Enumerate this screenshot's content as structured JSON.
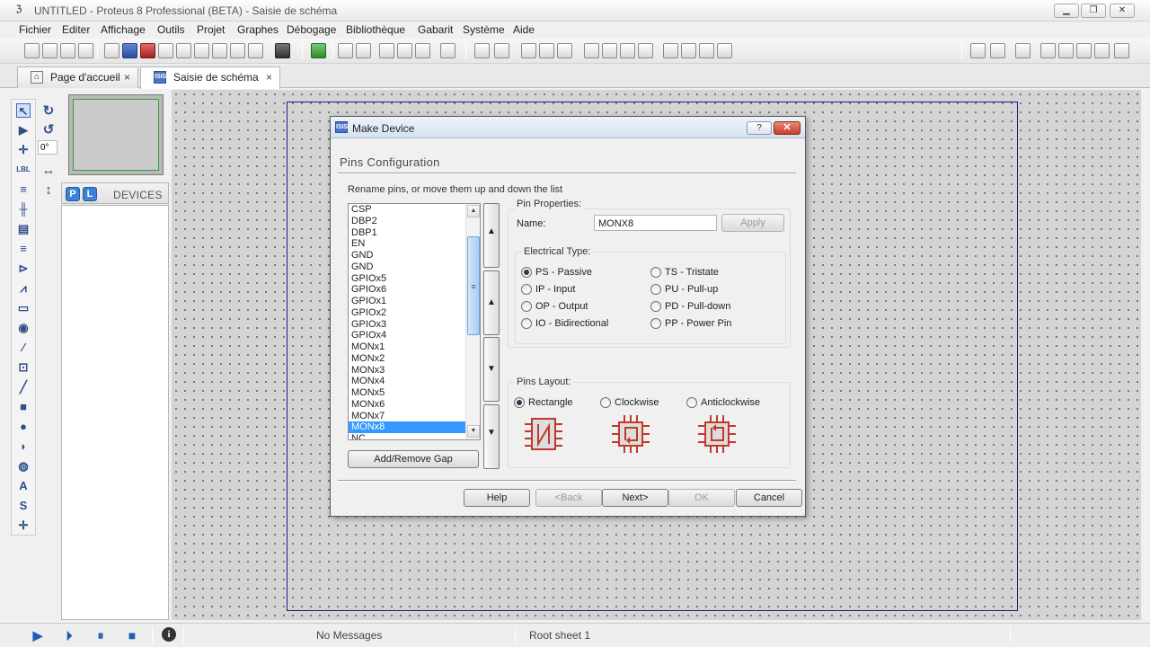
{
  "window": {
    "title": "UNTITLED - Proteus 8 Professional (BETA) - Saisie de schéma",
    "min_symbol": "▁",
    "max_symbol": "❐",
    "close_symbol": "✕"
  },
  "menu": [
    "Fichier",
    "Editer",
    "Affichage",
    "Outils",
    "Projet",
    "Graphes",
    "Débogage",
    "Bibliothèque",
    "Gabarit",
    "Système",
    "Aide"
  ],
  "tabs": [
    {
      "label": "Page d'accueil",
      "close": "×"
    },
    {
      "label": "Saisie de schéma",
      "close": "×"
    }
  ],
  "side_panel": {
    "rotation_value": "0°",
    "p_button": "P",
    "l_button": "L",
    "devices_label": "DEVICES"
  },
  "dialog": {
    "title": "Make Device",
    "help_button": "?",
    "close_button": "✕",
    "heading": "Pins Configuration",
    "description": "Rename pins, or move them up and down the list",
    "pins": [
      "CSP",
      "DBP2",
      "DBP1",
      "EN",
      "GND",
      "GND",
      "GPIOx5",
      "GPIOx6",
      "GPIOx1",
      "GPIOx2",
      "GPIOx3",
      "GPIOx4",
      "MONx1",
      "MONx2",
      "MONx3",
      "MONx4",
      "MONx5",
      "MONx6",
      "MONx7",
      "MONx8",
      "NC"
    ],
    "selected_pin_index": 19,
    "add_remove_gap": "Add/Remove Gap",
    "move_buttons": [
      "▲",
      "▲",
      "▼",
      "▼"
    ],
    "pin_properties": {
      "group_label": "Pin Properties:",
      "name_label": "Name:",
      "name_value": "MONX8",
      "apply": "Apply"
    },
    "electrical_type": {
      "group_label": "Electrical Type:",
      "options_left": [
        "PS - Passive",
        "IP - Input",
        "OP - Output",
        "IO - Bidirectional"
      ],
      "options_right": [
        "TS - Tristate",
        "PU - Pull-up",
        "PD - Pull-down",
        "PP - Power Pin"
      ],
      "selected": "PS - Passive"
    },
    "pins_layout": {
      "group_label": "Pins Layout:",
      "options": [
        "Rectangle",
        "Clockwise",
        "Anticlockwise"
      ],
      "selected": "Rectangle"
    },
    "buttons": {
      "help": "Help",
      "back": "<Back",
      "next": "Next>",
      "ok": "OK",
      "cancel": "Cancel"
    }
  },
  "status": {
    "messages": "No Messages",
    "sheet": "Root sheet 1",
    "info_icon": "i"
  },
  "colors": {
    "selection": "#3399ff",
    "sheet_border": "#1c1c8a",
    "chip_red": "#c0392b"
  }
}
